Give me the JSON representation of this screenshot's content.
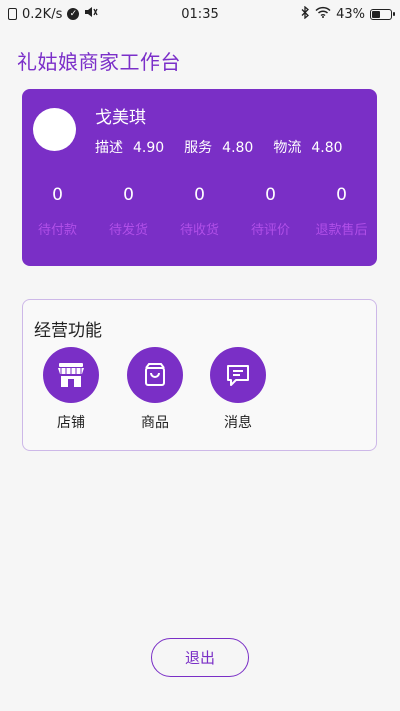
{
  "status_bar": {
    "speed": "0.2K/s",
    "time": "01:35",
    "battery": "43%",
    "battery_level": 0.43
  },
  "page": {
    "title": "礼姑娘商家工作台"
  },
  "profile": {
    "name": "戈美琪",
    "ratings": [
      {
        "label": "描述",
        "value": "4.90"
      },
      {
        "label": "服务",
        "value": "4.80"
      },
      {
        "label": "物流",
        "value": "4.80"
      }
    ],
    "order_stats": [
      {
        "count": "0",
        "label": "待付款"
      },
      {
        "count": "0",
        "label": "待发货"
      },
      {
        "count": "0",
        "label": "待收货"
      },
      {
        "count": "0",
        "label": "待评价"
      },
      {
        "count": "0",
        "label": "退款售后"
      }
    ]
  },
  "functions": {
    "title": "经营功能",
    "items": [
      {
        "label": "店铺",
        "icon": "store-icon"
      },
      {
        "label": "商品",
        "icon": "shopping-bag-icon"
      },
      {
        "label": "消息",
        "icon": "message-icon"
      }
    ]
  },
  "logout_label": "退出",
  "colors": {
    "primary": "#7a2fc6",
    "stat_label": "#b04fe8",
    "title": "#7b2fc9"
  }
}
